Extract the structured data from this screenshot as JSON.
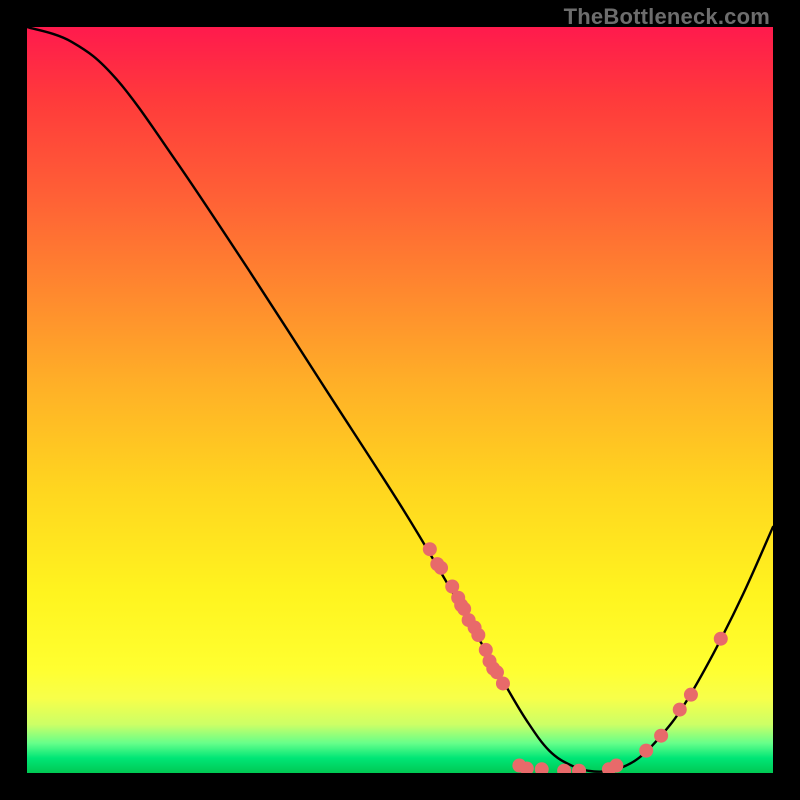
{
  "attribution": "TheBottleneck.com",
  "chart_data": {
    "type": "line",
    "title": "",
    "xlabel": "",
    "ylabel": "",
    "xlim": [
      0,
      100
    ],
    "ylim": [
      0,
      100
    ],
    "curve": [
      {
        "x": 0,
        "y": 100
      },
      {
        "x": 6,
        "y": 98
      },
      {
        "x": 12,
        "y": 93
      },
      {
        "x": 20,
        "y": 82
      },
      {
        "x": 30,
        "y": 67
      },
      {
        "x": 40,
        "y": 51.5
      },
      {
        "x": 50,
        "y": 36
      },
      {
        "x": 56,
        "y": 26
      },
      {
        "x": 60,
        "y": 19
      },
      {
        "x": 64,
        "y": 12
      },
      {
        "x": 67,
        "y": 7
      },
      {
        "x": 70,
        "y": 3
      },
      {
        "x": 73,
        "y": 1
      },
      {
        "x": 76,
        "y": 0.2
      },
      {
        "x": 79,
        "y": 0.5
      },
      {
        "x": 82,
        "y": 2
      },
      {
        "x": 85,
        "y": 5
      },
      {
        "x": 88,
        "y": 9
      },
      {
        "x": 92,
        "y": 16
      },
      {
        "x": 96,
        "y": 24
      },
      {
        "x": 100,
        "y": 33
      }
    ],
    "points": [
      {
        "x": 54,
        "y": 30
      },
      {
        "x": 55,
        "y": 28
      },
      {
        "x": 55.5,
        "y": 27.5
      },
      {
        "x": 57,
        "y": 25
      },
      {
        "x": 57.8,
        "y": 23.5
      },
      {
        "x": 58.2,
        "y": 22.5
      },
      {
        "x": 58.6,
        "y": 22
      },
      {
        "x": 59.2,
        "y": 20.5
      },
      {
        "x": 60,
        "y": 19.5
      },
      {
        "x": 60.5,
        "y": 18.5
      },
      {
        "x": 61.5,
        "y": 16.5
      },
      {
        "x": 62,
        "y": 15
      },
      {
        "x": 62.5,
        "y": 14
      },
      {
        "x": 63,
        "y": 13.5
      },
      {
        "x": 63.8,
        "y": 12
      },
      {
        "x": 66,
        "y": 1
      },
      {
        "x": 67,
        "y": 0.6
      },
      {
        "x": 69,
        "y": 0.5
      },
      {
        "x": 72,
        "y": 0.3
      },
      {
        "x": 74,
        "y": 0.3
      },
      {
        "x": 78,
        "y": 0.5
      },
      {
        "x": 79,
        "y": 1
      },
      {
        "x": 83,
        "y": 3
      },
      {
        "x": 85,
        "y": 5
      },
      {
        "x": 87.5,
        "y": 8.5
      },
      {
        "x": 89,
        "y": 10.5
      },
      {
        "x": 93,
        "y": 18
      }
    ],
    "colors": {
      "curve": "#000000",
      "point_fill": "#e86a6a",
      "point_stroke": "#c94f4f"
    }
  }
}
